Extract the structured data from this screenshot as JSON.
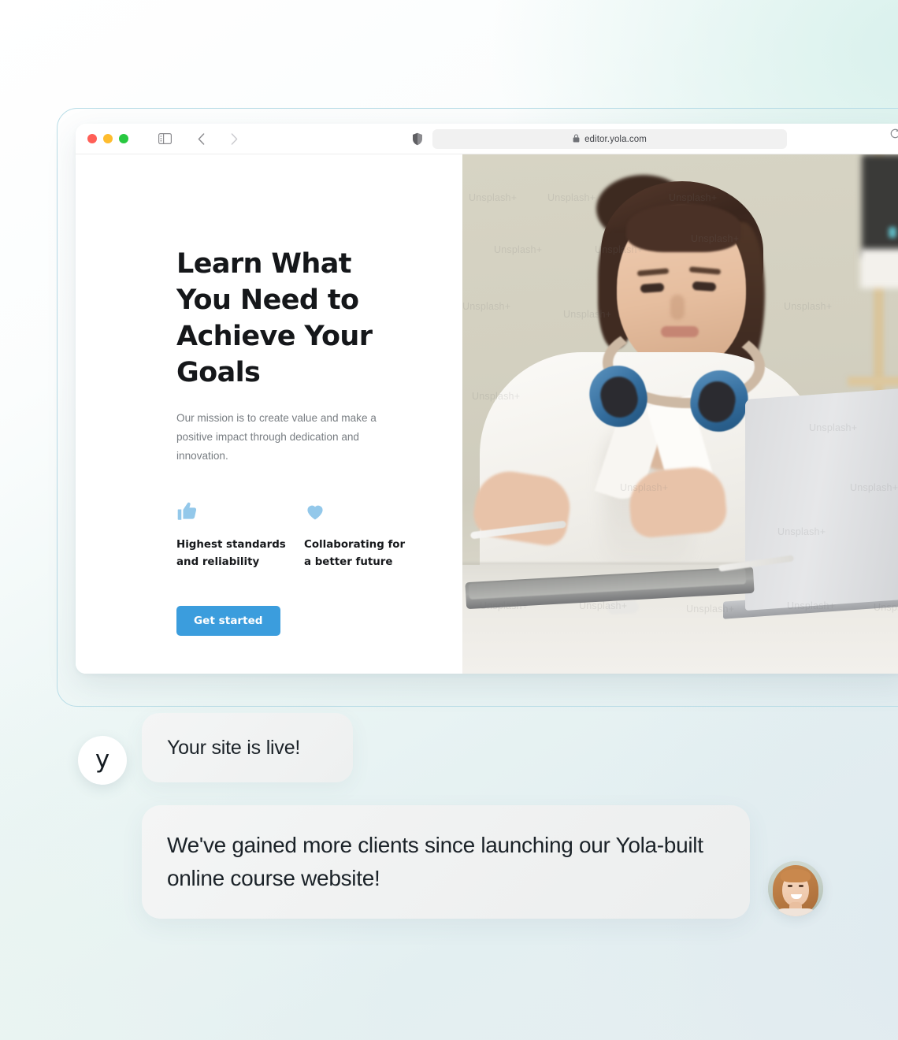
{
  "browser": {
    "traffic_lights": [
      {
        "name": "close",
        "color": "#ff5f57"
      },
      {
        "name": "minimize",
        "color": "#febc2e"
      },
      {
        "name": "maximize",
        "color": "#28c840"
      }
    ],
    "sidebar_toggle_icon": "sidebar-toggle-icon",
    "back_icon": "chevron-left-icon",
    "forward_icon": "chevron-right-icon",
    "shield_icon": "privacy-shield-icon",
    "lock_icon": "lock-icon",
    "reload_icon": "reload-icon",
    "url": "editor.yola.com"
  },
  "hero": {
    "headline": "Learn What You Need to Achieve Your Goals",
    "subtext": "Our mission is to create value and make a positive impact through dedication and innovation.",
    "features": [
      {
        "icon": "thumbs-up-icon",
        "label": "Highest standards and reliability"
      },
      {
        "icon": "heart-icon",
        "label": "Collaborating for a better future"
      }
    ],
    "cta_label": "Get started",
    "photo_alt": "woman-with-headphones-working-on-tablet-and-laptop",
    "watermark_text": "Unsplash+"
  },
  "chat": {
    "brand_mark": "y",
    "message_one": "Your site is live!",
    "message_two": "We've gained more clients since launching our Yola-built online course website!",
    "client_avatar_alt": "smiling-woman-portrait"
  },
  "colors": {
    "accent_blue": "#3b9ddd",
    "icon_blue": "#93c8ea",
    "headline": "#15171a",
    "body_text": "#787d82",
    "bubble_bg": "#f2f3f3",
    "frame_border": "#b9dde7"
  }
}
